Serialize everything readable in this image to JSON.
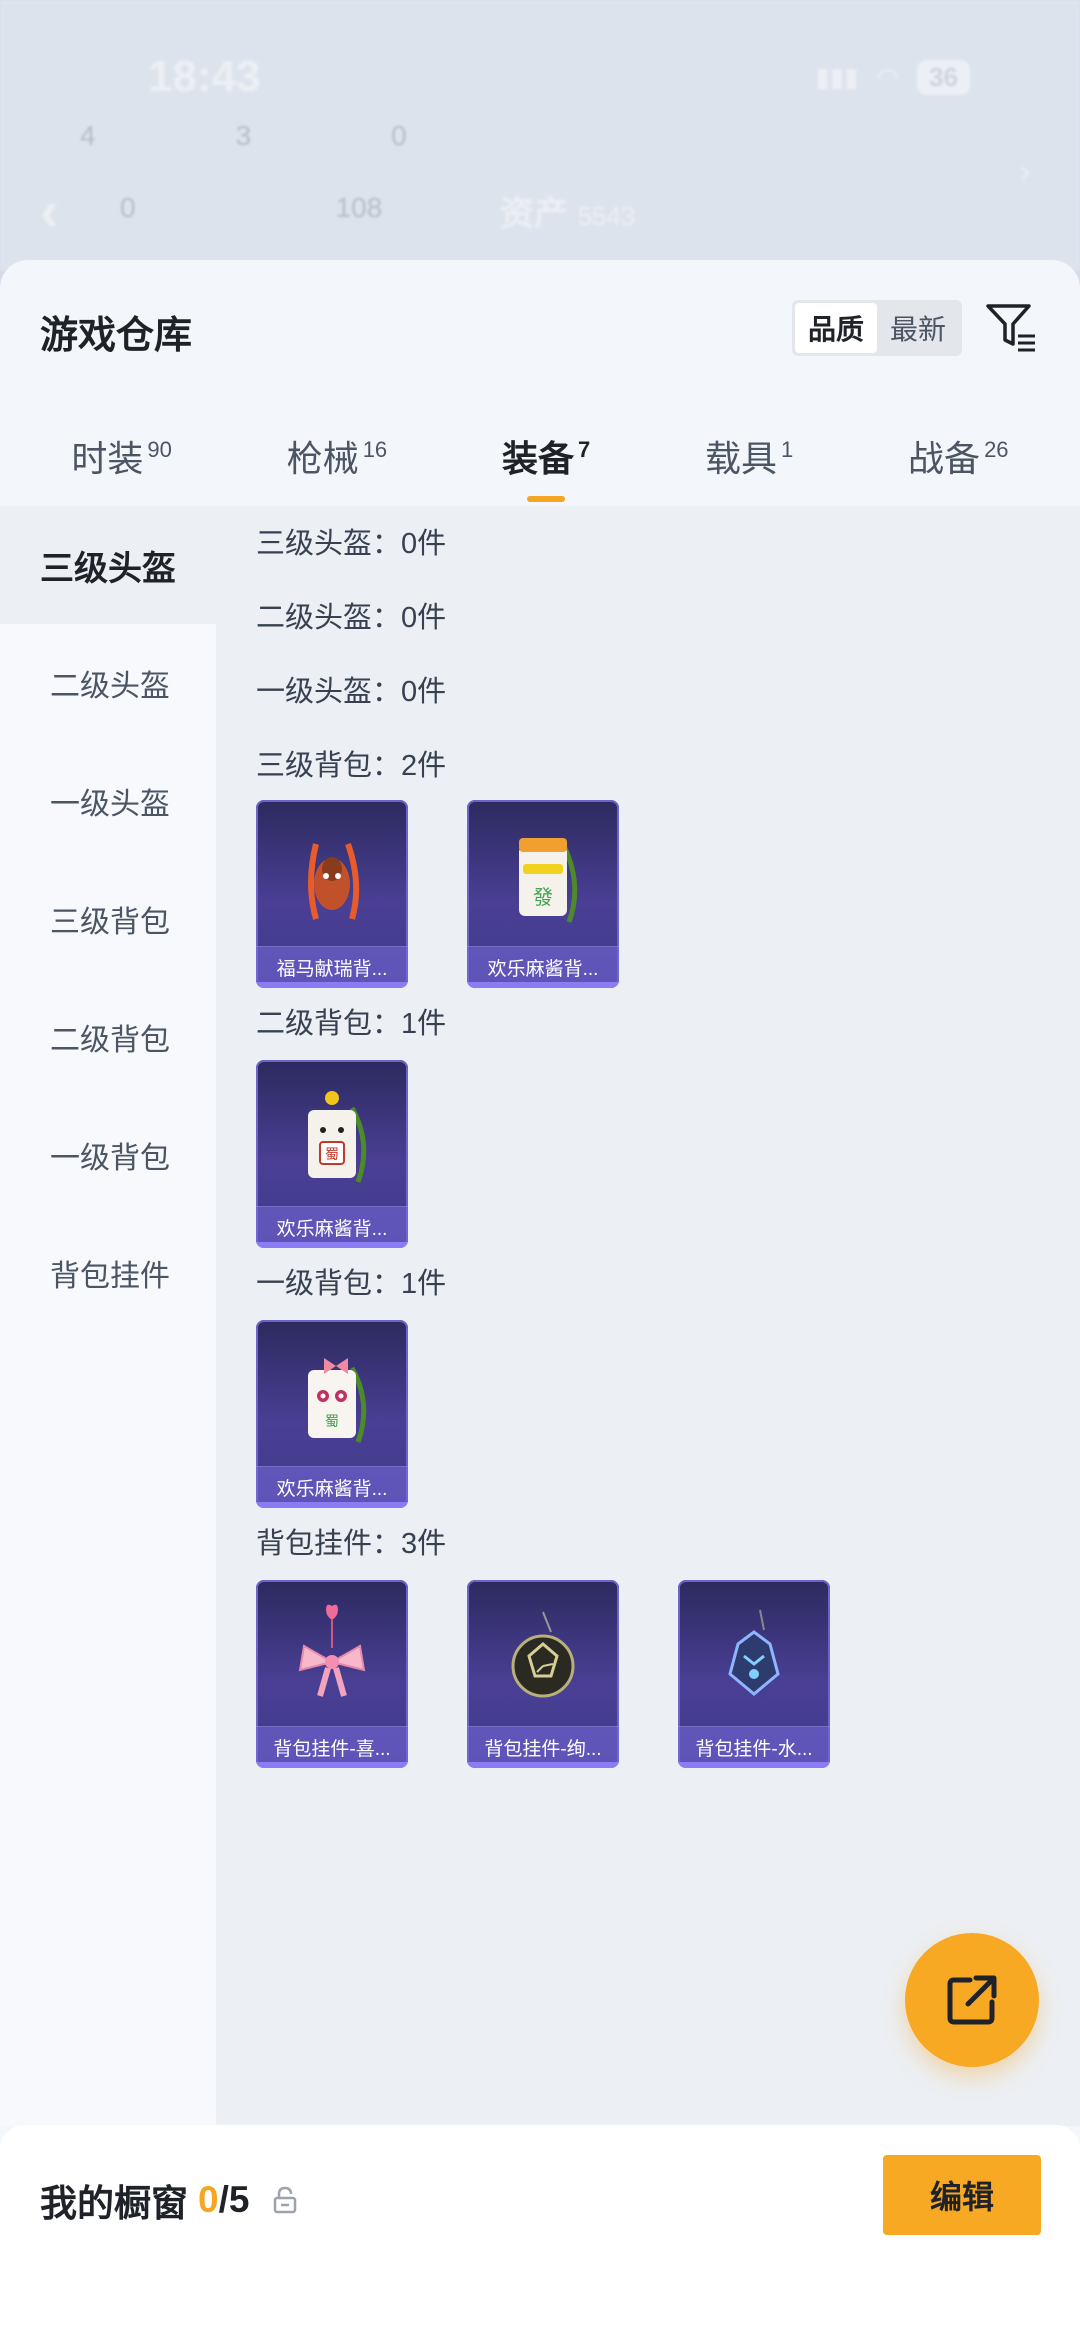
{
  "background": {
    "time": "18:43",
    "battery": "36",
    "row1": [
      "4",
      "3",
      "0"
    ],
    "row2": [
      "0",
      "108"
    ],
    "asset_label": "资产",
    "asset_value": "5543"
  },
  "header": {
    "title": "游戏仓库",
    "sort_options": [
      "品质",
      "最新"
    ],
    "sort_selected": "品质"
  },
  "tabs": [
    {
      "label": "时装",
      "count": "90"
    },
    {
      "label": "枪械",
      "count": "16"
    },
    {
      "label": "装备",
      "count": "7",
      "active": true
    },
    {
      "label": "载具",
      "count": "1"
    },
    {
      "label": "战备",
      "count": "26"
    }
  ],
  "sidebar": {
    "items": [
      "三级头盔",
      "二级头盔",
      "一级头盔",
      "三级背包",
      "二级背包",
      "一级背包",
      "背包挂件"
    ],
    "active": "三级头盔"
  },
  "sections": [
    {
      "title": "三级头盔：0件",
      "items": []
    },
    {
      "title": "二级头盔：0件",
      "items": []
    },
    {
      "title": "一级头盔：0件",
      "items": []
    },
    {
      "title": "三级背包：2件",
      "items": [
        {
          "name": "福马献瑞背...",
          "icon": "horse-backpack-icon"
        },
        {
          "name": "欢乐麻酱背...",
          "icon": "mahjong-fa-backpack-icon"
        }
      ]
    },
    {
      "title": "二级背包：1件",
      "items": [
        {
          "name": "欢乐麻酱背...",
          "icon": "mahjong-shu-backpack-icon"
        }
      ]
    },
    {
      "title": "一级背包：1件",
      "items": [
        {
          "name": "欢乐麻酱背...",
          "icon": "mahjong-bow-backpack-icon"
        }
      ]
    },
    {
      "title": "背包挂件：3件",
      "items": [
        {
          "name": "背包挂件-喜...",
          "icon": "pink-bow-charm-icon"
        },
        {
          "name": "背包挂件-绚...",
          "icon": "ball-charm-icon"
        },
        {
          "name": "背包挂件-水...",
          "icon": "dragon-charm-icon"
        }
      ]
    }
  ],
  "bottom_bar": {
    "showcase_label": "我的橱窗",
    "showcase_count": "0",
    "showcase_total": "/5",
    "edit_label": "编辑"
  },
  "colors": {
    "accent": "#f7a923",
    "card": "#3e3a8a"
  }
}
